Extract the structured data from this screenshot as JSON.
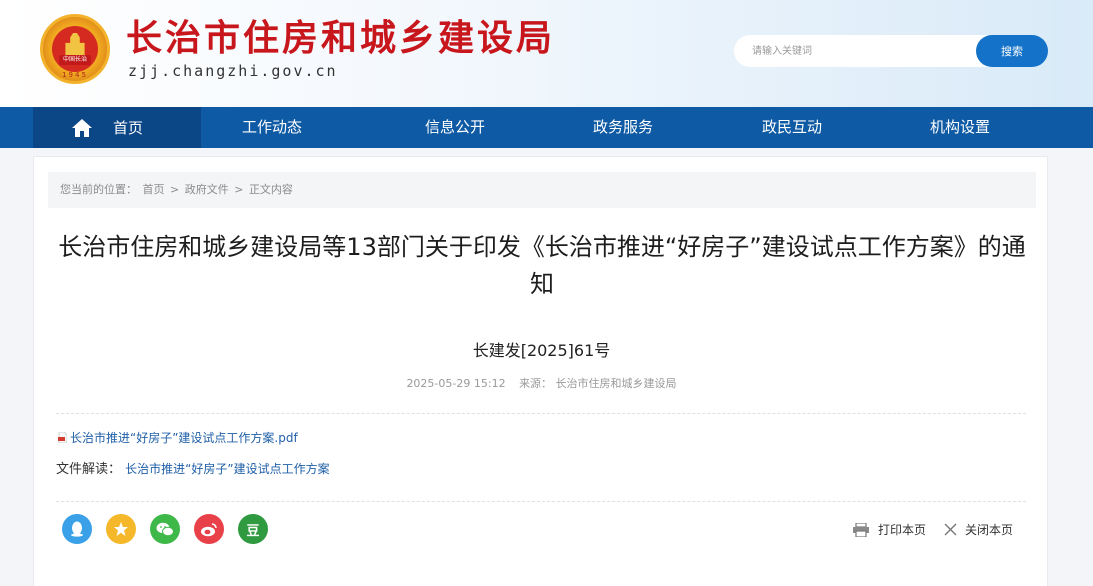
{
  "header": {
    "site_title": "长治市住房和城乡建设局",
    "site_url": "zjj.changzhi.gov.cn",
    "emblem_text": "中国长治",
    "emblem_year": "1945",
    "search_placeholder": "请输入关键词",
    "search_button": "搜索"
  },
  "nav": {
    "items": [
      {
        "label": "首页",
        "active": true
      },
      {
        "label": "工作动态"
      },
      {
        "label": "信息公开"
      },
      {
        "label": "政务服务"
      },
      {
        "label": "政民互动"
      },
      {
        "label": "机构设置"
      }
    ]
  },
  "breadcrumb": {
    "prefix": "您当前的位置：",
    "items": [
      "首页",
      "政府文件",
      "正文内容"
    ],
    "separator": ">"
  },
  "article": {
    "title": "长治市住房和城乡建设局等13部门关于印发《长治市推进“好房子”建设试点工作方案》的通知",
    "doc_number": "长建发[2025]61号",
    "datetime": "2025-05-29 15:12",
    "source_label": "来源：",
    "source": "长治市住房和城乡建设局",
    "attachment": "长治市推进“好房子”建设试点工作方案.pdf",
    "interpret_label": "文件解读：",
    "interpret_link": "长治市推进“好房子”建设试点工作方案"
  },
  "share": {
    "icons": [
      {
        "name": "qq-icon",
        "color": "#3aa0e8"
      },
      {
        "name": "qzone-icon",
        "color": "#f5b82a"
      },
      {
        "name": "wechat-icon",
        "color": "#3fb84a"
      },
      {
        "name": "weibo-icon",
        "color": "#e8414a"
      },
      {
        "name": "douban-icon",
        "color": "#2f9a3f",
        "glyph": "豆"
      }
    ]
  },
  "tools": {
    "print": "打印本页",
    "close": "关闭本页"
  },
  "colors": {
    "brand_red": "#c8161d",
    "nav_blue": "#0f5aa4",
    "nav_active": "#0b4687",
    "link_blue": "#1f5fa8"
  }
}
